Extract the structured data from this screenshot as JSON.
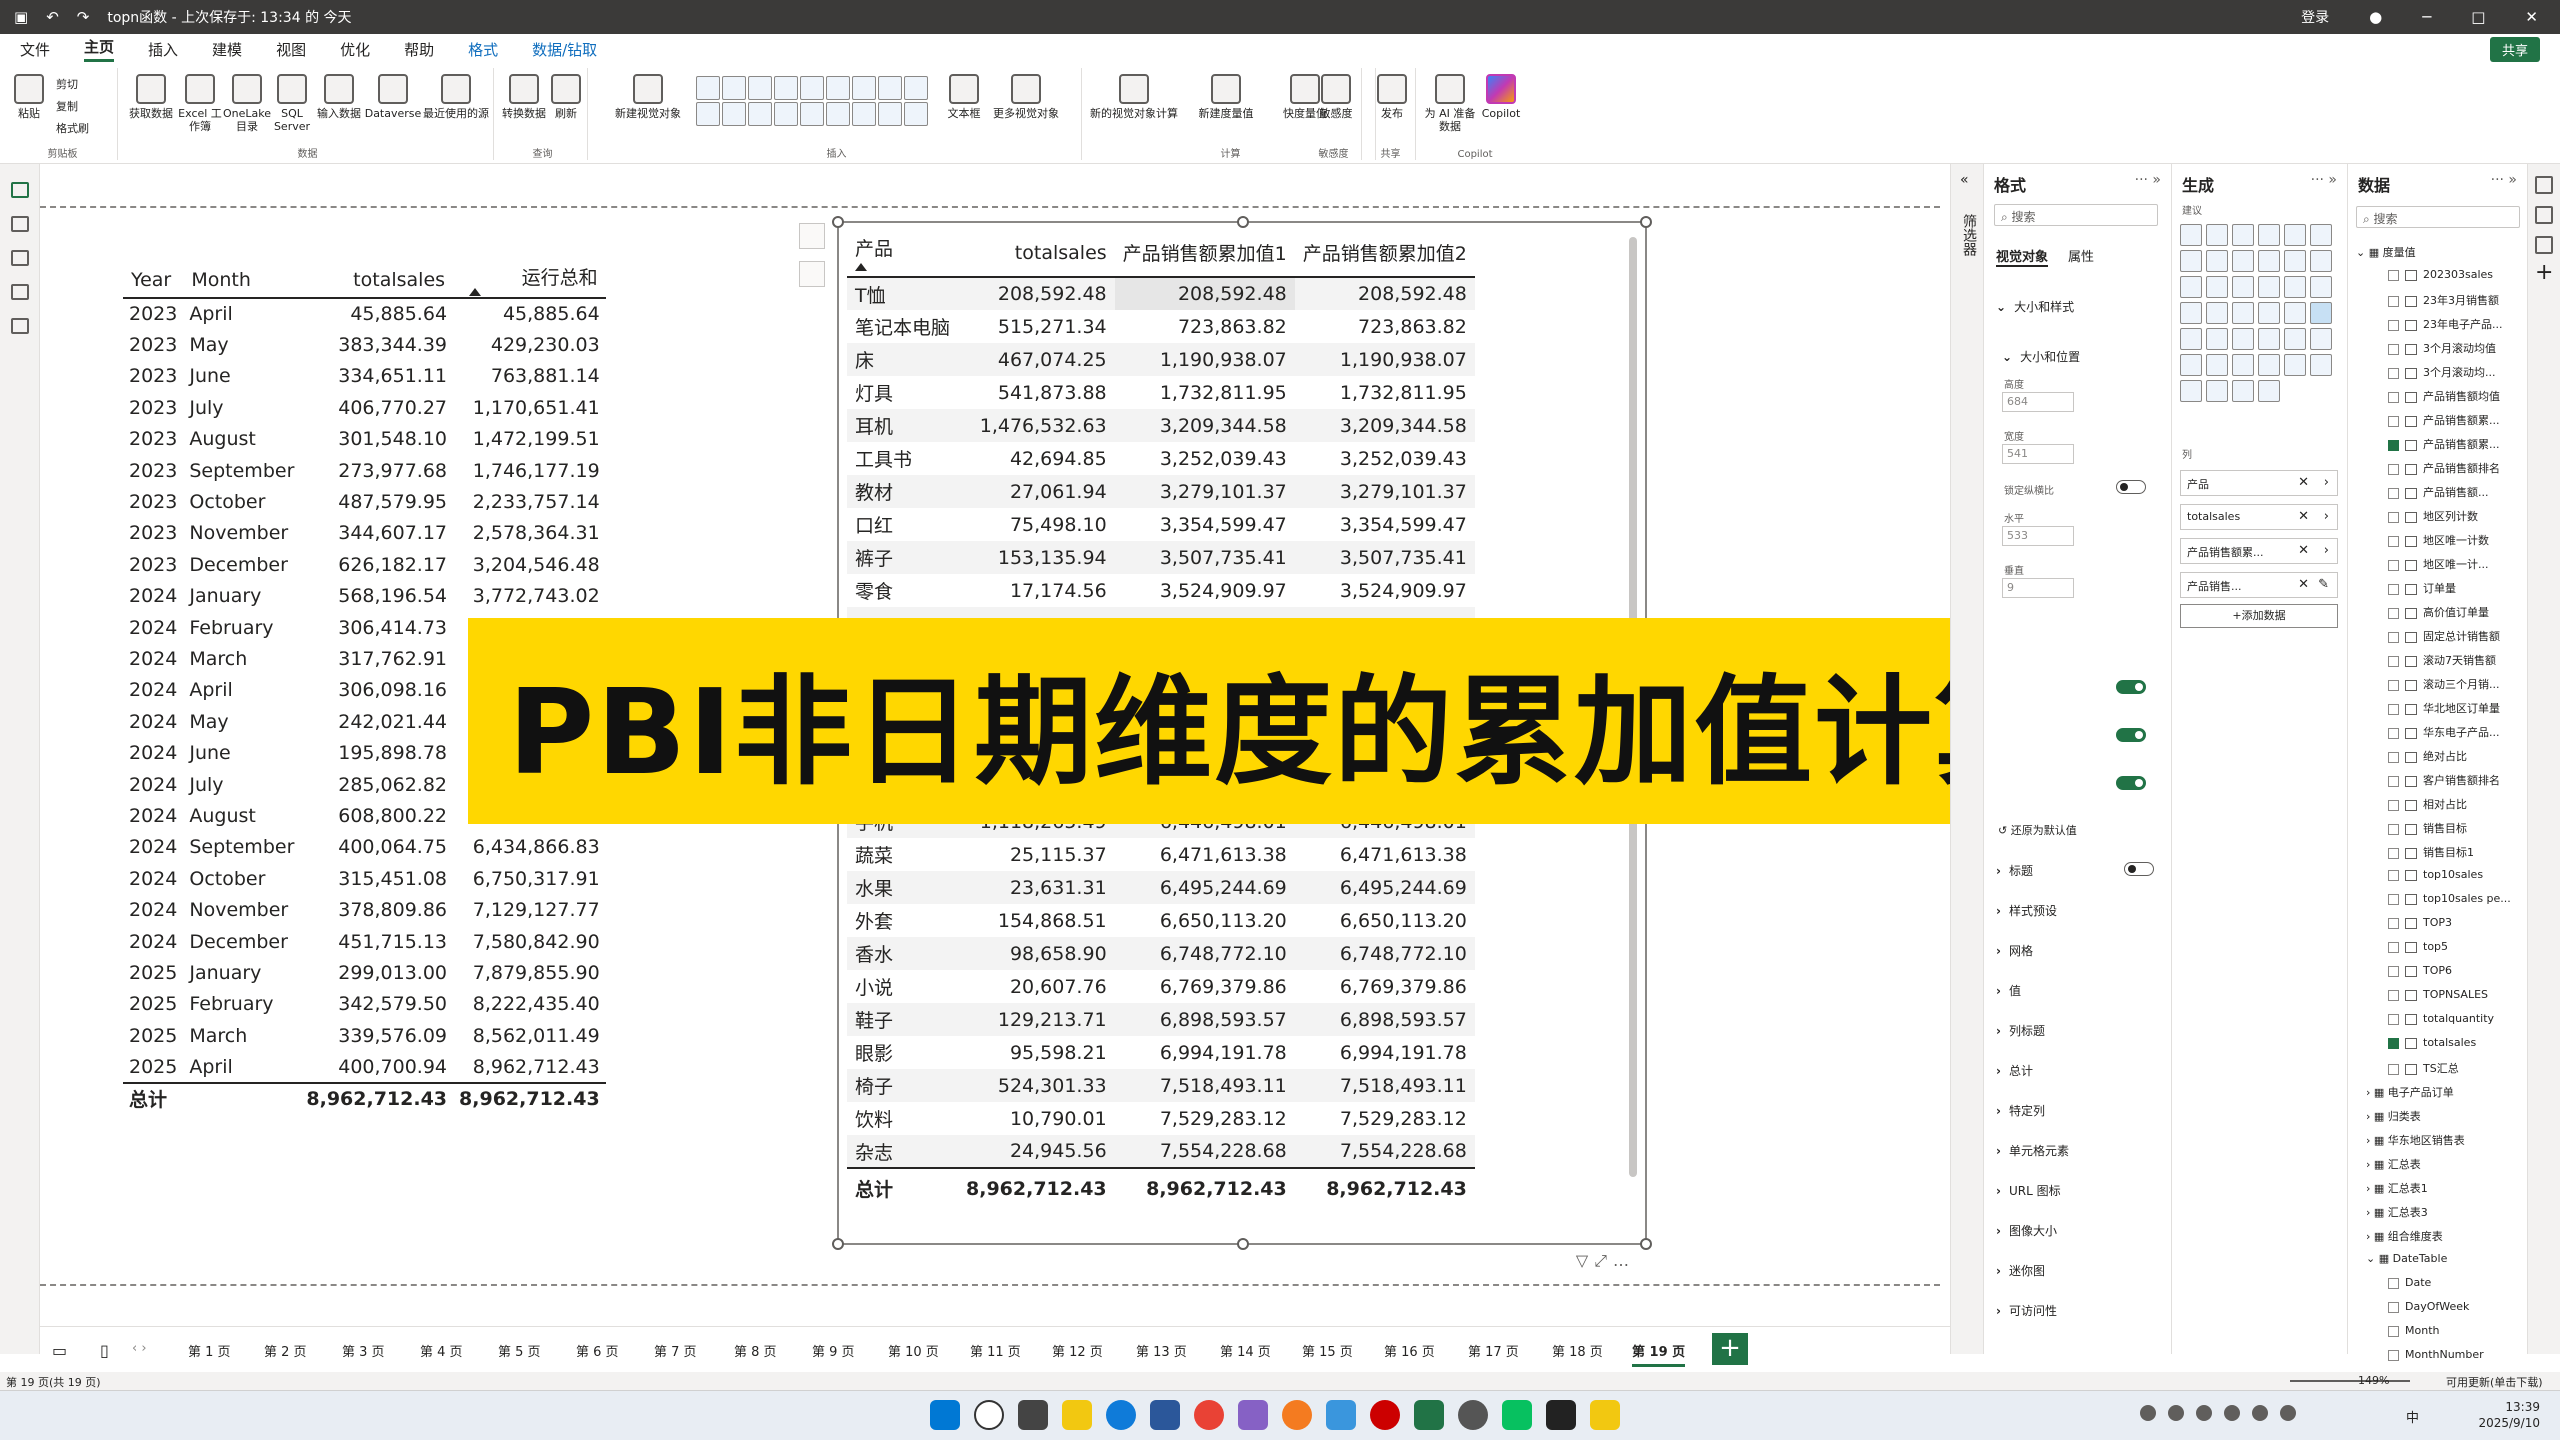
{
  "titlebar": {
    "title": "topn函数 - 上次保存于: 13:34 的 今天",
    "signin": "登录",
    "controls": [
      "─",
      "□",
      "✕"
    ]
  },
  "menu": {
    "items": [
      "文件",
      "主页",
      "插入",
      "建模",
      "视图",
      "优化",
      "帮助",
      "格式",
      "数据/钻取"
    ],
    "active": "主页",
    "share": "共享"
  },
  "ribbon": {
    "clipboard": {
      "paste": "粘贴",
      "cut": "剪切",
      "copy": "复制",
      "format_painter": "格式刷",
      "label": "剪贴板"
    },
    "data": {
      "get_data": "获取数据",
      "excel": "Excel 工作簿",
      "onelake": "OneLake 目录",
      "sql": "SQL Server",
      "enter_data": "输入数据",
      "dataverse": "Dataverse",
      "recent": "最近使用的源",
      "label": "数据"
    },
    "query": {
      "transform": "转换数据",
      "refresh": "刷新",
      "label": "查询"
    },
    "insert": {
      "new_visual": "新建视觉对象",
      "text_box": "文本框",
      "more_visuals": "更多视觉对象",
      "label": "插入"
    },
    "calc": {
      "new_visual_calc": "新的视觉对象计算",
      "new_measure": "新建度量值",
      "quick_measure": "快度量值",
      "label": "计算"
    },
    "sensitivity": {
      "btn": "敏感度",
      "label": "敏感度"
    },
    "share": {
      "publish": "发布",
      "label": "共享"
    },
    "copilot": {
      "ai": "为 AI 准备数据",
      "copilot": "Copilot",
      "label": "Copilot"
    }
  },
  "table1": {
    "headers": [
      "Year",
      "Month",
      "totalsales",
      "运行总和"
    ],
    "rows": [
      [
        "2023",
        "April",
        "45,885.64",
        "45,885.64"
      ],
      [
        "2023",
        "May",
        "383,344.39",
        "429,230.03"
      ],
      [
        "2023",
        "June",
        "334,651.11",
        "763,881.14"
      ],
      [
        "2023",
        "July",
        "406,770.27",
        "1,170,651.41"
      ],
      [
        "2023",
        "August",
        "301,548.10",
        "1,472,199.51"
      ],
      [
        "2023",
        "September",
        "273,977.68",
        "1,746,177.19"
      ],
      [
        "2023",
        "October",
        "487,579.95",
        "2,233,757.14"
      ],
      [
        "2023",
        "November",
        "344,607.17",
        "2,578,364.31"
      ],
      [
        "2023",
        "December",
        "626,182.17",
        "3,204,546.48"
      ],
      [
        "2024",
        "January",
        "568,196.54",
        "3,772,743.02"
      ],
      [
        "2024",
        "February",
        "306,414.73",
        ""
      ],
      [
        "2024",
        "March",
        "317,762.91",
        ""
      ],
      [
        "2024",
        "April",
        "306,098.16",
        ""
      ],
      [
        "2024",
        "May",
        "242,021.44",
        ""
      ],
      [
        "2024",
        "June",
        "195,898.78",
        ""
      ],
      [
        "2024",
        "July",
        "285,062.82",
        ""
      ],
      [
        "2024",
        "August",
        "608,800.22",
        "6,034,802.08"
      ],
      [
        "2024",
        "September",
        "400,064.75",
        "6,434,866.83"
      ],
      [
        "2024",
        "October",
        "315,451.08",
        "6,750,317.91"
      ],
      [
        "2024",
        "November",
        "378,809.86",
        "7,129,127.77"
      ],
      [
        "2024",
        "December",
        "451,715.13",
        "7,580,842.90"
      ],
      [
        "2025",
        "January",
        "299,013.00",
        "7,879,855.90"
      ],
      [
        "2025",
        "February",
        "342,579.50",
        "8,222,435.40"
      ],
      [
        "2025",
        "March",
        "339,576.09",
        "8,562,011.49"
      ],
      [
        "2025",
        "April",
        "400,700.94",
        "8,962,712.43"
      ]
    ],
    "total": [
      "总计",
      "",
      "8,962,712.43",
      "8,962,712.43"
    ]
  },
  "table2": {
    "headers": [
      "产品",
      "totalsales",
      "产品销售额累加值1",
      "产品销售额累加值2"
    ],
    "rows": [
      [
        "T恤",
        "208,592.48",
        "208,592.48",
        "208,592.48"
      ],
      [
        "笔记本电脑",
        "515,271.34",
        "723,863.82",
        "723,863.82"
      ],
      [
        "床",
        "467,074.25",
        "1,190,938.07",
        "1,190,938.07"
      ],
      [
        "灯具",
        "541,873.88",
        "1,732,811.95",
        "1,732,811.95"
      ],
      [
        "耳机",
        "1,476,532.63",
        "3,209,344.58",
        "3,209,344.58"
      ],
      [
        "工具书",
        "42,694.85",
        "3,252,039.43",
        "3,252,039.43"
      ],
      [
        "教材",
        "27,061.94",
        "3,279,101.37",
        "3,279,101.37"
      ],
      [
        "口红",
        "75,498.10",
        "3,354,599.47",
        "3,354,599.47"
      ],
      [
        "裤子",
        "153,135.94",
        "3,507,735.41",
        "3,507,735.41"
      ],
      [
        "零食",
        "17,174.56",
        "3,524,909.97",
        "3,524,909.97"
      ],
      [
        "",
        "",
        "",
        ""
      ],
      [
        "",
        "",
        "",
        ""
      ],
      [
        "",
        "",
        "",
        ""
      ],
      [
        "",
        "",
        "",
        ""
      ],
      [
        "",
        "",
        "",
        ""
      ],
      [
        "",
        "",
        "",
        ""
      ],
      [
        "手机",
        "1,118,265.49",
        "6,446,498.01",
        "6,446,498.01"
      ],
      [
        "蔬菜",
        "25,115.37",
        "6,471,613.38",
        "6,471,613.38"
      ],
      [
        "水果",
        "23,631.31",
        "6,495,244.69",
        "6,495,244.69"
      ],
      [
        "外套",
        "154,868.51",
        "6,650,113.20",
        "6,650,113.20"
      ],
      [
        "香水",
        "98,658.90",
        "6,748,772.10",
        "6,748,772.10"
      ],
      [
        "小说",
        "20,607.76",
        "6,769,379.86",
        "6,769,379.86"
      ],
      [
        "鞋子",
        "129,213.71",
        "6,898,593.57",
        "6,898,593.57"
      ],
      [
        "眼影",
        "95,598.21",
        "6,994,191.78",
        "6,994,191.78"
      ],
      [
        "椅子",
        "524,301.33",
        "7,518,493.11",
        "7,518,493.11"
      ],
      [
        "饮料",
        "10,790.01",
        "7,529,283.12",
        "7,529,283.12"
      ],
      [
        "杂志",
        "24,945.56",
        "7,554,228.68",
        "7,554,228.68"
      ]
    ],
    "total": [
      "总计",
      "8,962,712.43",
      "8,962,712.43",
      "8,962,712.43"
    ]
  },
  "banner": {
    "text": "PBI非日期维度的累加值计算"
  },
  "filters": {
    "label": "筛选器"
  },
  "format_pane": {
    "title": "格式",
    "search_placeholder": "搜索",
    "tab_visual": "视觉对象",
    "tab_general": "属性",
    "size_style": "大小和样式",
    "size_position": "大小和位置",
    "height_label": "高度",
    "height_value": "684",
    "width_label": "宽度",
    "width_value": "541",
    "lock_ratio": "锁定纵横比",
    "horizontal_label": "水平",
    "horizontal_value": "533",
    "vertical_label": "垂直",
    "vertical_value": "9",
    "reset": "还原为默认值",
    "sections": [
      "标题",
      "样式预设",
      "网格",
      "值",
      "列标题",
      "总计",
      "特定列",
      "单元格元素",
      "URL 图标",
      "图像大小",
      "迷你图",
      "可访问性"
    ]
  },
  "build_pane": {
    "title": "生成",
    "suggest": "建议",
    "columns": "列",
    "wells": [
      "产品",
      "totalsales",
      "产品销售额累...",
      "产品销售..."
    ],
    "add_data": "+添加数据"
  },
  "data_pane": {
    "title": "数据",
    "search_placeholder": "搜索",
    "group": "度量值",
    "fields": [
      {
        "name": "202303sales",
        "checked": false
      },
      {
        "name": "23年3月销售额",
        "checked": false
      },
      {
        "name": "23年电子产品...",
        "checked": false
      },
      {
        "name": "3个月滚动均值",
        "checked": false
      },
      {
        "name": "3个月滚动均...",
        "checked": false
      },
      {
        "name": "产品销售额均值",
        "checked": false
      },
      {
        "name": "产品销售额累...",
        "checked": false
      },
      {
        "name": "产品销售额累...",
        "checked": true
      },
      {
        "name": "产品销售额排名",
        "checked": false
      },
      {
        "name": "产品销售额...",
        "checked": false
      },
      {
        "name": "地区列计数",
        "checked": false
      },
      {
        "name": "地区唯一计数",
        "checked": false
      },
      {
        "name": "地区唯一计...",
        "checked": false
      },
      {
        "name": "订单量",
        "checked": false
      },
      {
        "name": "高价值订单量",
        "checked": false
      },
      {
        "name": "固定总计销售额",
        "checked": false
      },
      {
        "name": "滚动7天销售额",
        "checked": false
      },
      {
        "name": "滚动三个月销...",
        "checked": false
      },
      {
        "name": "华北地区订单量",
        "checked": false
      },
      {
        "name": "华东电子产品...",
        "checked": false
      },
      {
        "name": "绝对占比",
        "checked": false
      },
      {
        "name": "客户销售额排名",
        "checked": false
      },
      {
        "name": "相对占比",
        "checked": false
      },
      {
        "name": "销售目标",
        "checked": false
      },
      {
        "name": "销售目标1",
        "checked": false
      },
      {
        "name": "top10sales",
        "checked": false
      },
      {
        "name": "top10sales pe...",
        "checked": false
      },
      {
        "name": "TOP3",
        "checked": false
      },
      {
        "name": "top5",
        "checked": false
      },
      {
        "name": "TOP6",
        "checked": false
      },
      {
        "name": "TOPNSALES",
        "checked": false
      },
      {
        "name": "totalquantity",
        "checked": false
      },
      {
        "name": "totalsales",
        "checked": true
      },
      {
        "name": "TS汇总",
        "checked": false
      }
    ],
    "tables": [
      "电子产品订单",
      "归类表",
      "华东地区销售表",
      "汇总表",
      "汇总表1",
      "汇总表3",
      "组合维度表",
      "DateTable"
    ],
    "datetable_fields": [
      "Date",
      "DayOfWeek",
      "Month",
      "MonthNumber"
    ]
  },
  "pages": {
    "tabs": [
      "第 1 页",
      "第 2 页",
      "第 3 页",
      "第 4 页",
      "第 5 页",
      "第 6 页",
      "第 7 页",
      "第 8 页",
      "第 9 页",
      "第 10 页",
      "第 11 页",
      "第 12 页",
      "第 13 页",
      "第 14 页",
      "第 15 页",
      "第 16 页",
      "第 17 页",
      "第 18 页",
      "第 19 页"
    ],
    "active": "第 19 页",
    "add": "+"
  },
  "status": {
    "left": "第 19 页(共 19 页)",
    "zoom": "149%",
    "right": "可用更新(单击下载)"
  },
  "taskbar": {
    "time": "13:39",
    "date": "2025/9/10",
    "lang": "中"
  }
}
